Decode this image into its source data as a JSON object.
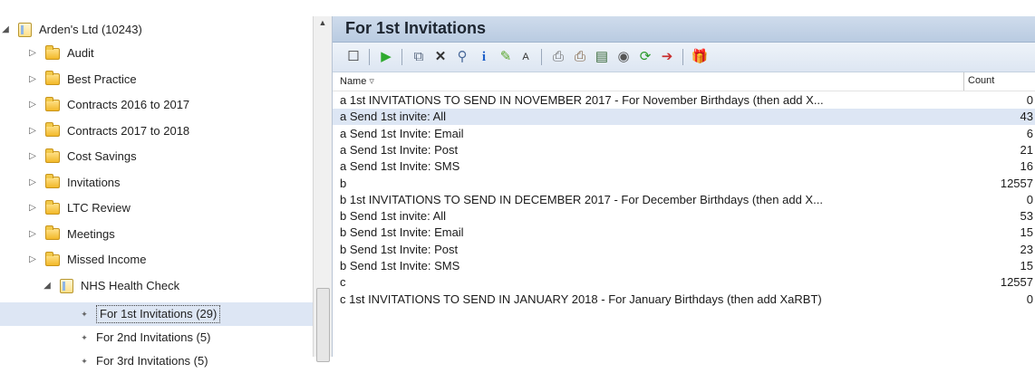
{
  "tree": {
    "root_label": "Arden's Ltd (10243)",
    "folders": [
      "Audit",
      "Best Practice",
      "Contracts 2016 to 2017",
      "Contracts 2017 to 2018",
      "Cost Savings",
      "Invitations",
      "LTC Review",
      "Meetings",
      "Missed Income"
    ],
    "open_folder": "NHS Health Check",
    "children": [
      "For 1st Invitations (29)",
      "For 2nd Invitations (5)",
      "For 3rd Invitations (5)"
    ],
    "selected_child_index": 0
  },
  "panel": {
    "title": "For 1st Invitations",
    "columns": {
      "name": "Name",
      "count": "Count"
    }
  },
  "toolbar_icons": [
    "select-all-icon",
    "run-icon",
    "copy-icon",
    "delete-icon",
    "search-icon",
    "info-icon",
    "edit-icon",
    "font-icon",
    "print-icon",
    "print-preview-icon",
    "export-icon",
    "record-icon",
    "refresh-icon",
    "forward-icon",
    "gift-icon"
  ],
  "rows": [
    {
      "name": "a  1st INVITATIONS TO SEND IN NOVEMBER 2017 - For November Birthdays (then add X...",
      "count": "0"
    },
    {
      "name": "a Send 1st invite: All",
      "count": "43"
    },
    {
      "name": "a Send 1st Invite: Email",
      "count": "6"
    },
    {
      "name": "a Send 1st Invite: Post",
      "count": "21"
    },
    {
      "name": "a Send 1st Invite: SMS",
      "count": "16"
    },
    {
      "name": "b",
      "count": "12557"
    },
    {
      "name": "b  1st INVITATIONS TO SEND IN DECEMBER 2017 - For December Birthdays (then add X...",
      "count": "0"
    },
    {
      "name": "b Send 1st invite: All",
      "count": "53"
    },
    {
      "name": "b Send 1st Invite: Email",
      "count": "15"
    },
    {
      "name": "b Send 1st Invite: Post",
      "count": "23"
    },
    {
      "name": "b Send 1st Invite: SMS",
      "count": "15"
    },
    {
      "name": "c",
      "count": "12557"
    },
    {
      "name": "c  1st INVITATIONS TO SEND IN JANUARY 2018 - For January Birthdays (then add XaRBT)",
      "count": "0"
    }
  ],
  "selected_row_index": 1,
  "colors": {
    "title_bar": "#c4d4e8",
    "selection": "#dde6f4",
    "folder": "#f2b829"
  }
}
